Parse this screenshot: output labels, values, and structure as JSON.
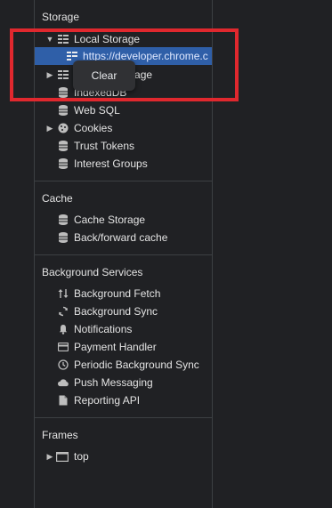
{
  "storage": {
    "title": "Storage",
    "local_storage": "Local Storage",
    "local_storage_origin": "https://developer.chrome.c",
    "session_storage": "Session Storage",
    "indexeddb": "IndexedDB",
    "web_sql": "Web SQL",
    "cookies": "Cookies",
    "trust_tokens": "Trust Tokens",
    "interest_groups": "Interest Groups"
  },
  "tooltip": {
    "label": "Clear"
  },
  "cache": {
    "title": "Cache",
    "cache_storage": "Cache Storage",
    "bfcache": "Back/forward cache"
  },
  "background_services": {
    "title": "Background Services",
    "background_fetch": "Background Fetch",
    "background_sync": "Background Sync",
    "notifications": "Notifications",
    "payment_handler": "Payment Handler",
    "periodic_background_sync": "Periodic Background Sync",
    "push_messaging": "Push Messaging",
    "reporting_api": "Reporting API"
  },
  "frames": {
    "title": "Frames",
    "top": "top"
  },
  "colors": {
    "selection": "#2f5fa8",
    "highlight": "#e0282e",
    "panel_bg": "#202124"
  }
}
